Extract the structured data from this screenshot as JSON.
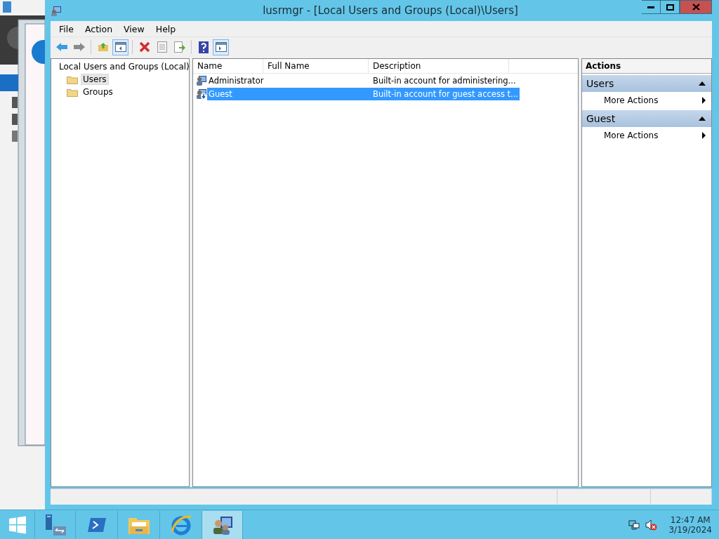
{
  "window": {
    "title": "lusrmgr - [Local Users and Groups (Local)\\Users]"
  },
  "menu": [
    "File",
    "Action",
    "View",
    "Help"
  ],
  "toolbar": [
    [
      {
        "kind": "back",
        "pressed": false
      },
      {
        "kind": "forward",
        "pressed": false
      }
    ],
    [
      {
        "kind": "up",
        "pressed": false
      },
      {
        "kind": "tree",
        "pressed": true
      }
    ],
    [
      {
        "kind": "delete",
        "pressed": false
      },
      {
        "kind": "properties",
        "pressed": false
      },
      {
        "kind": "export",
        "pressed": false
      }
    ],
    [
      {
        "kind": "help",
        "pressed": false
      },
      {
        "kind": "pane",
        "pressed": true
      }
    ]
  ],
  "tree": {
    "label": "Local Users and Groups (Local)",
    "children": [
      {
        "label": "Users",
        "selected": true
      },
      {
        "label": "Groups",
        "selected": false
      }
    ]
  },
  "table": {
    "columns": [
      "Name",
      "Full Name",
      "Description"
    ],
    "rows": [
      {
        "name": "Administrator",
        "description": "Built-in account for administering...",
        "selected": false
      },
      {
        "name": "Guest",
        "description": "Built-in account for guest access t...",
        "selected": true
      }
    ]
  },
  "actions": {
    "title": "Actions",
    "sections": [
      {
        "title": "Users",
        "expanded": true,
        "items": [
          "More Actions"
        ]
      },
      {
        "title": "Guest",
        "expanded": true,
        "items": [
          "More Actions"
        ]
      }
    ]
  },
  "taskbar": {
    "apps": [
      {
        "kind": "start",
        "active": false
      },
      {
        "kind": "server",
        "active": false
      },
      {
        "kind": "shell",
        "active": false
      },
      {
        "kind": "folder",
        "active": false
      },
      {
        "kind": "browser",
        "active": false
      },
      {
        "kind": "users",
        "active": true
      }
    ],
    "time": "12:47 AM",
    "date": "3/19/2024"
  }
}
